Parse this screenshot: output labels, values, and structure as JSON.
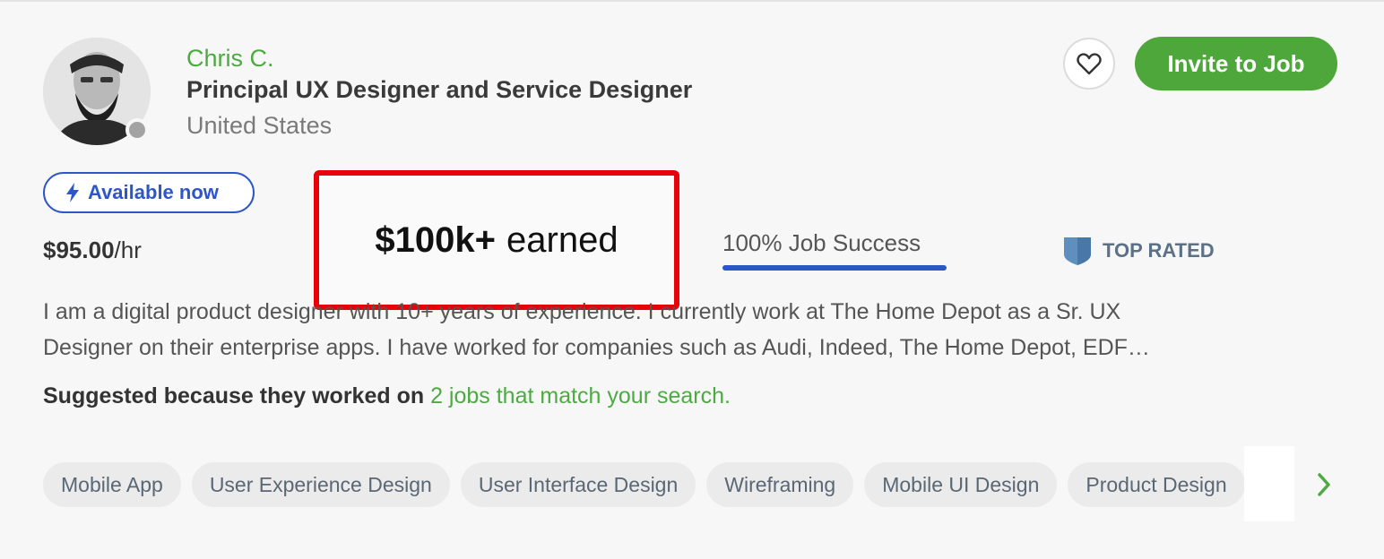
{
  "profile": {
    "name": "Chris C.",
    "title": "Principal UX Designer and Service Designer",
    "location": "United States"
  },
  "actions": {
    "favorite_icon": "heart-icon",
    "invite_label": "Invite to Job"
  },
  "availability": {
    "icon": "lightning-icon",
    "label": "Available now"
  },
  "rate": {
    "amount": "$95.00",
    "unit": "/hr"
  },
  "earnings": {
    "amount": "$100k+",
    "label": "earned"
  },
  "job_success": {
    "label": "100% Job Success",
    "value": 1.0
  },
  "badge": {
    "icon": "shield-badge-icon",
    "label": "TOP RATED"
  },
  "description": {
    "line1": "I am a digital product designer with 10+ years of experience. I currently work at The Home Depot as a Sr. UX",
    "line2": "Designer on their enterprise apps. I have worked for companies such as Audi, Indeed, The Home Depot, EDF…"
  },
  "suggestion": {
    "prefix": "Suggested because they worked on ",
    "link": "2 jobs that match your search."
  },
  "skills": [
    "Mobile App",
    "User Experience Design",
    "User Interface Design",
    "Wireframing",
    "Mobile UI Design",
    "Product Design"
  ],
  "colors": {
    "brand_green": "#4ea73a",
    "link_green": "#4daa42",
    "available_blue": "#2d56c9",
    "highlight_red": "#e8000b"
  }
}
